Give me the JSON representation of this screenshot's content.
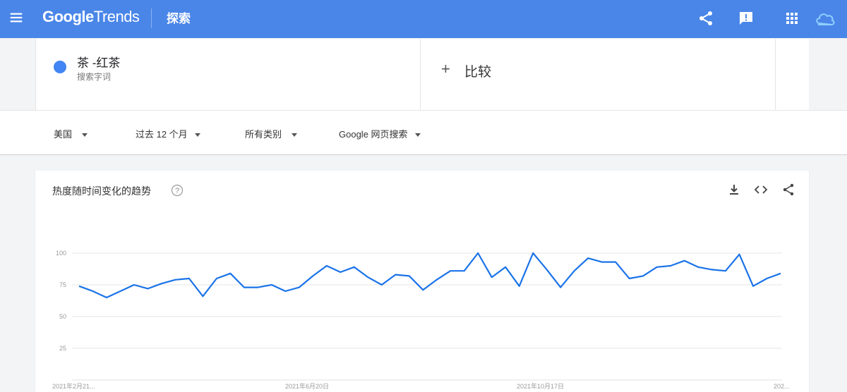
{
  "app": {
    "logo_google": "Google",
    "logo_trends": "Trends",
    "section": "探索"
  },
  "colors": {
    "topbar": "#4a86e8",
    "series": "#1a73e8",
    "term_dot": "#4285f4"
  },
  "top_icons": [
    "share-icon",
    "feedback-icon",
    "apps-grid-icon",
    "account-cloud-icon"
  ],
  "search": {
    "term": {
      "title": "茶 -红茶",
      "subtitle": "搜索字词"
    },
    "compare": {
      "plus": "+",
      "label": "比较"
    }
  },
  "filters": {
    "region": "美国",
    "time": "过去 12 个月",
    "category": "所有类别",
    "property": "Google 网页搜索"
  },
  "chart_card": {
    "title": "热度随时间变化的趋势",
    "actions": [
      "download-icon",
      "embed-code-icon",
      "share-icon"
    ]
  },
  "chart_data": {
    "type": "line",
    "title": "热度随时间变化的趋势",
    "ylim": [
      0,
      100
    ],
    "yticks": [
      "25",
      "50",
      "75",
      "100"
    ],
    "xticks": [
      "2021年2月21...",
      "2021年6月20日",
      "2021年10月17日",
      "202..."
    ],
    "grid": true,
    "series": [
      {
        "values": [
          74,
          70,
          65,
          70,
          75,
          72,
          76,
          79,
          80,
          66,
          80,
          84,
          73,
          73,
          75,
          70,
          73,
          82,
          90,
          85,
          89,
          81,
          75,
          83,
          82,
          71,
          79,
          86,
          86,
          100,
          81,
          89,
          74,
          100,
          87,
          73,
          86,
          96,
          93,
          93,
          80,
          82,
          89,
          90,
          94,
          89,
          87,
          86,
          99,
          74,
          80,
          84
        ]
      }
    ]
  }
}
